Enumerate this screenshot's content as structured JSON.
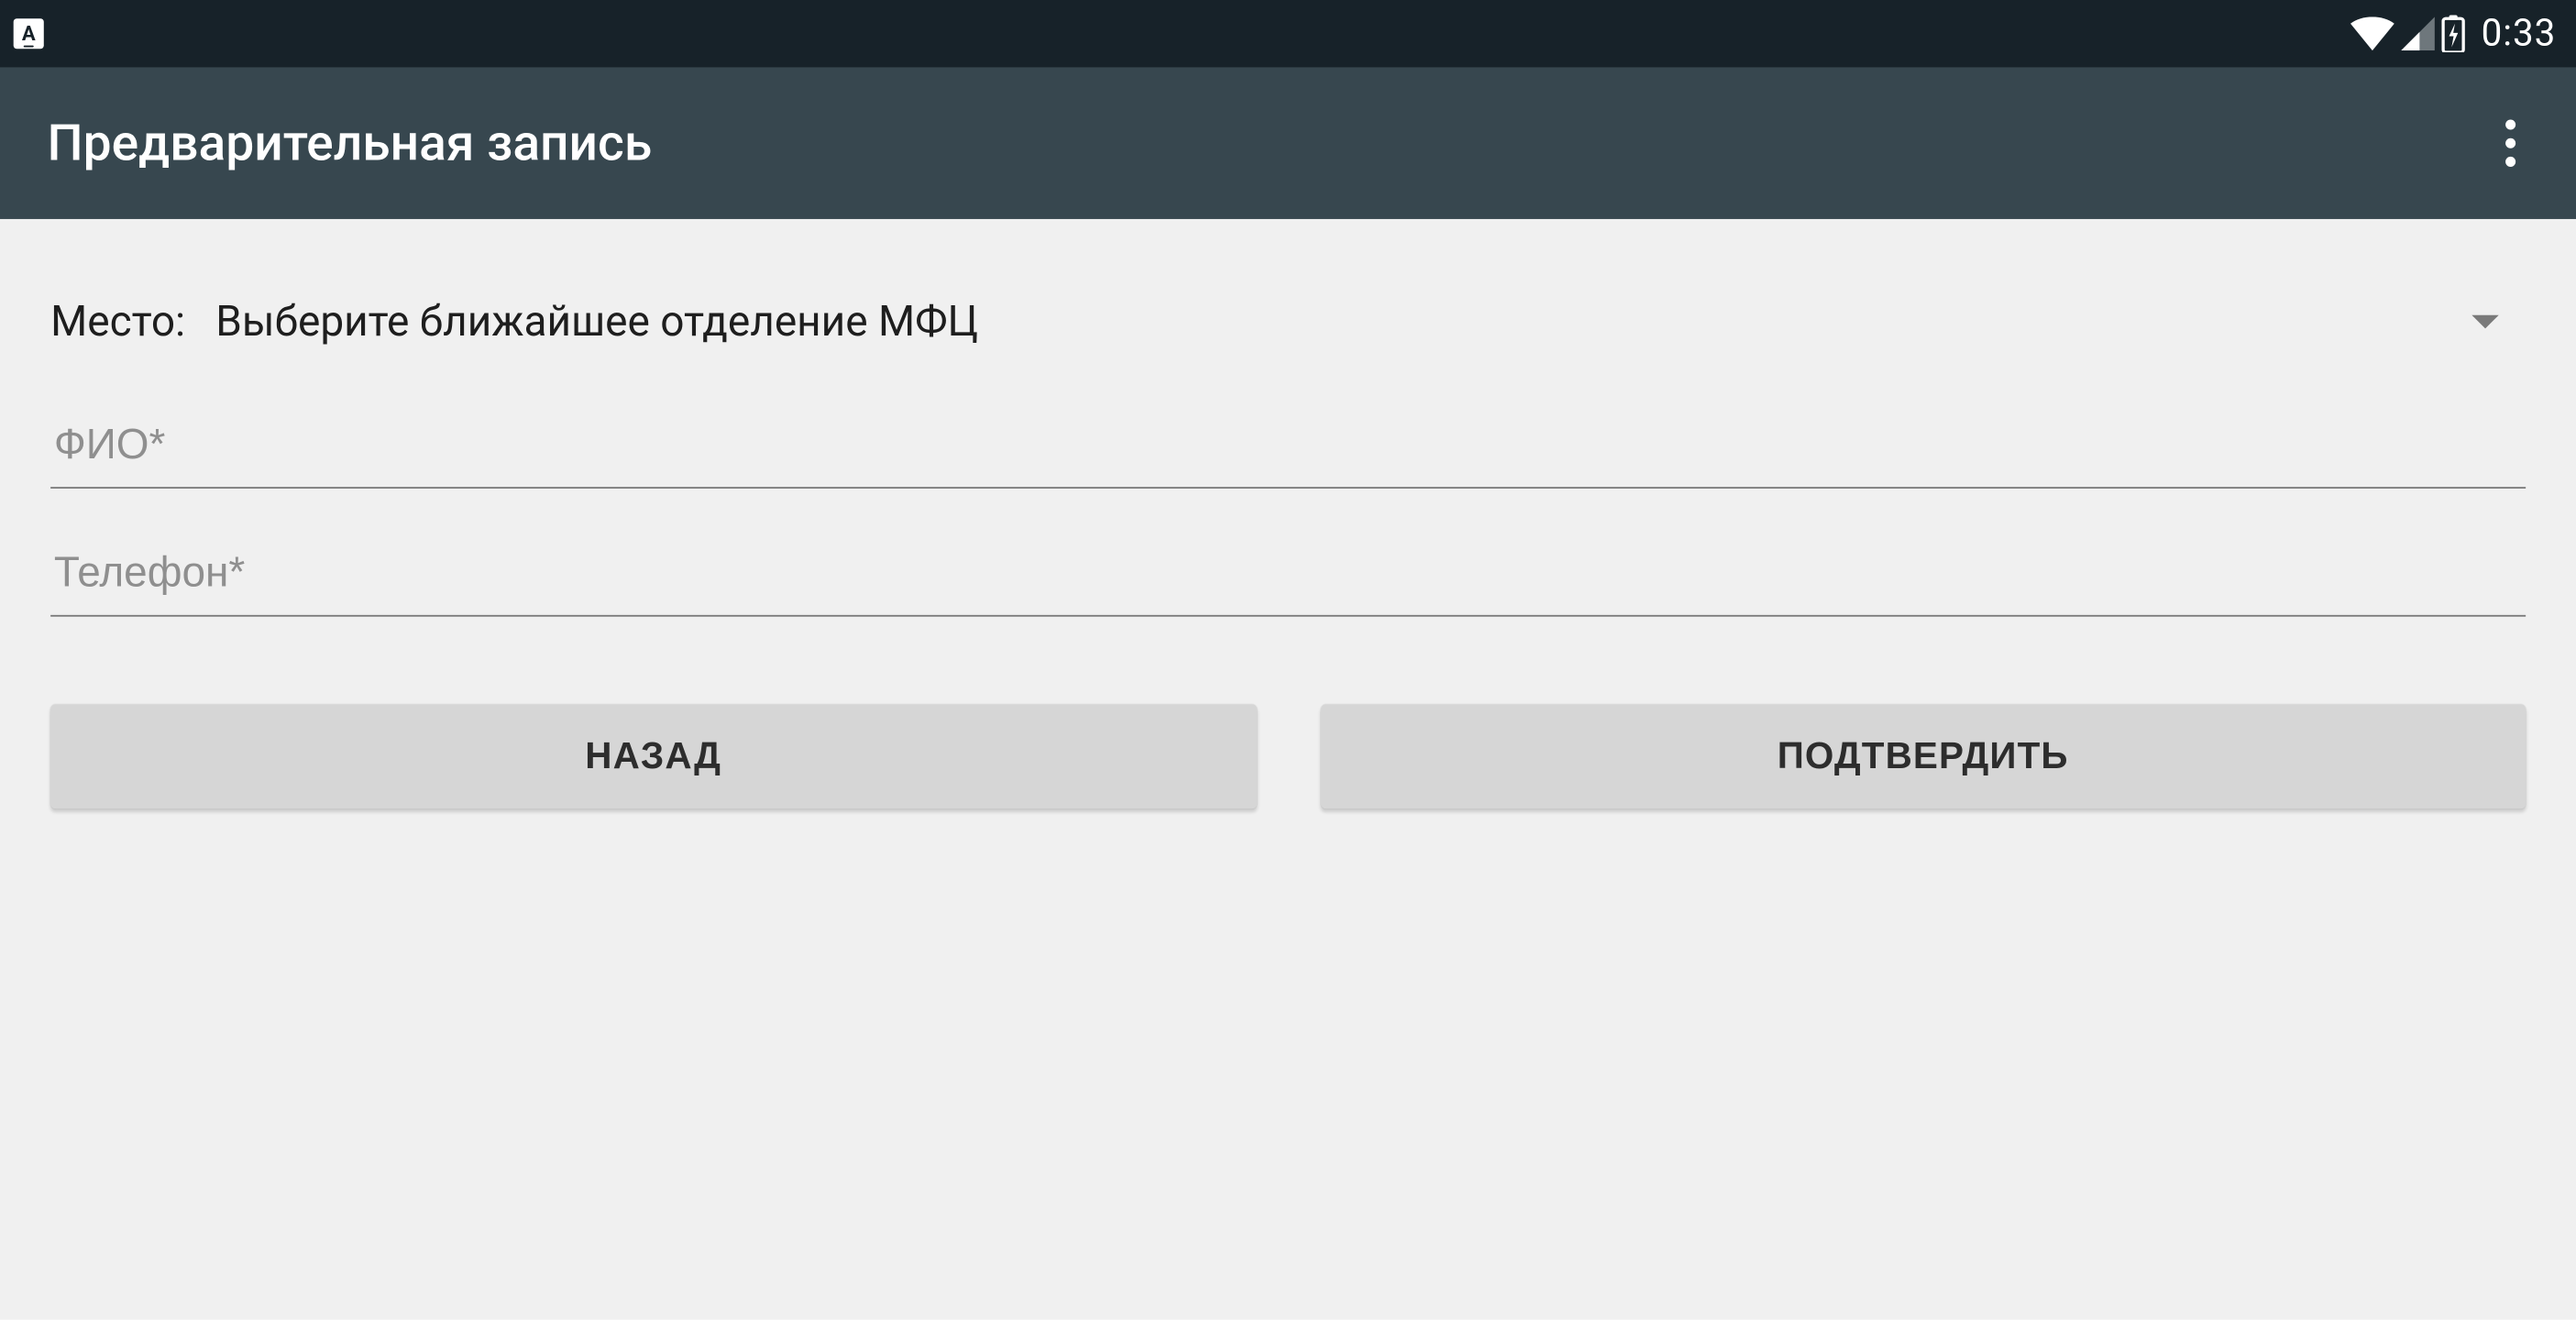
{
  "status": {
    "time": "0:33"
  },
  "header": {
    "title": "Предварительная запись"
  },
  "form": {
    "place_label": "Место:",
    "place_value": "Выберите ближайшее отделение МФЦ",
    "fio_placeholder": "ФИО*",
    "phone_placeholder": "Телефон*",
    "back_label": "НАЗАД",
    "confirm_label": "ПОДТВЕРДИТЬ"
  }
}
